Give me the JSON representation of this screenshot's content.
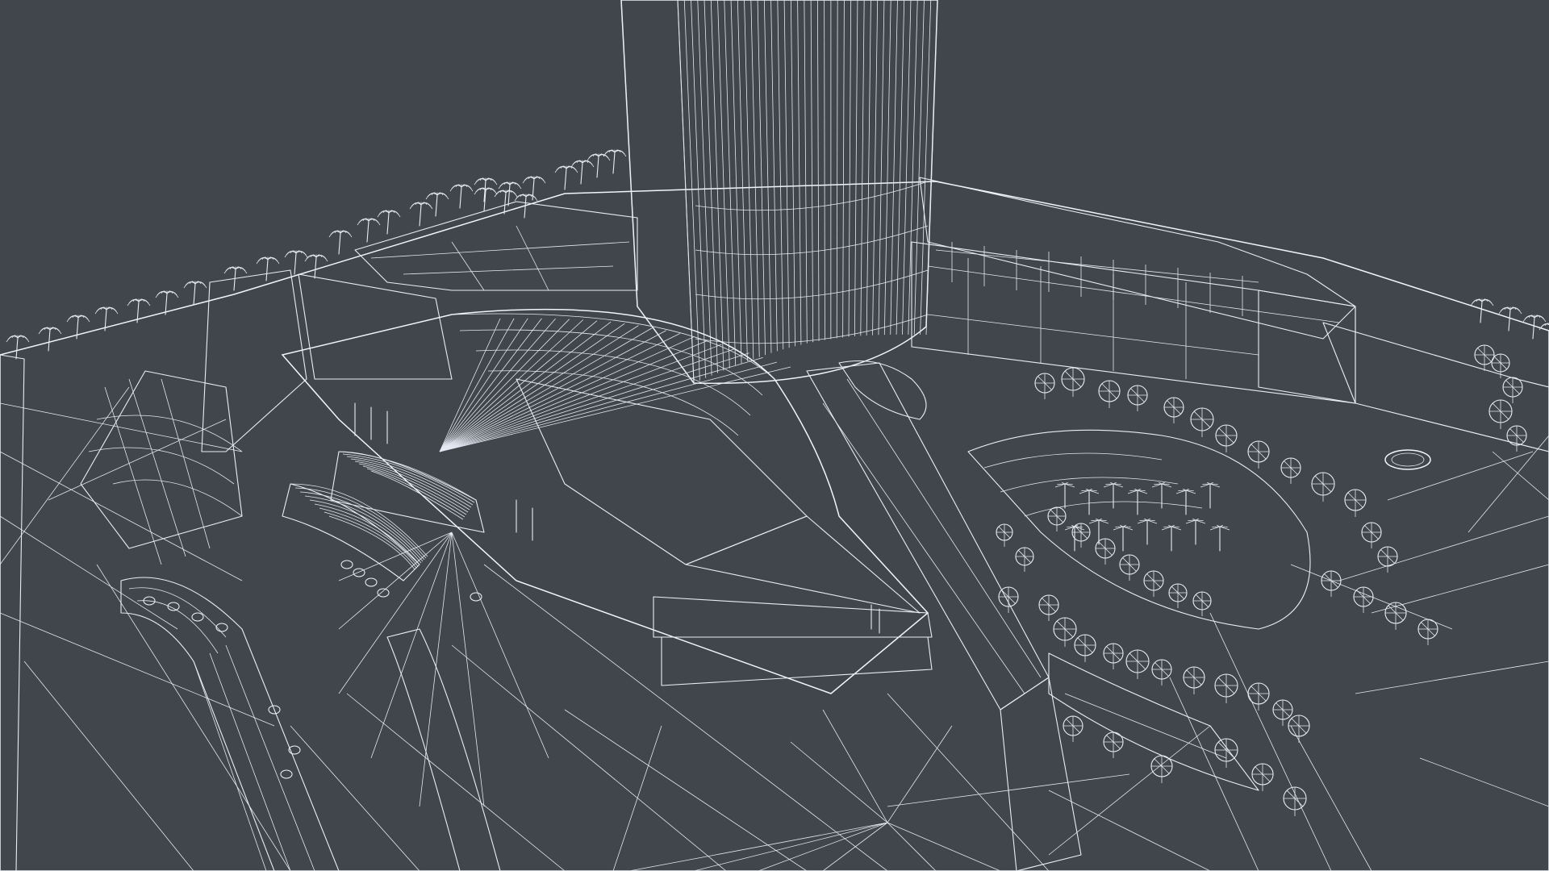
{
  "viewport": {
    "type": "3d-wireframe-render",
    "subject": "architectural-site-model",
    "colors": {
      "background": "#40464b",
      "surface": "#6f7893",
      "surface_light": "#8d95ad",
      "surface_dark": "#4f566b",
      "wire": "#e9edf6"
    },
    "elements": {
      "tower": "cylindrical-tower",
      "podium": "curved-podium-roof",
      "landscape": "site-landscape-with-trees",
      "palms": "palm-tree-row"
    }
  }
}
